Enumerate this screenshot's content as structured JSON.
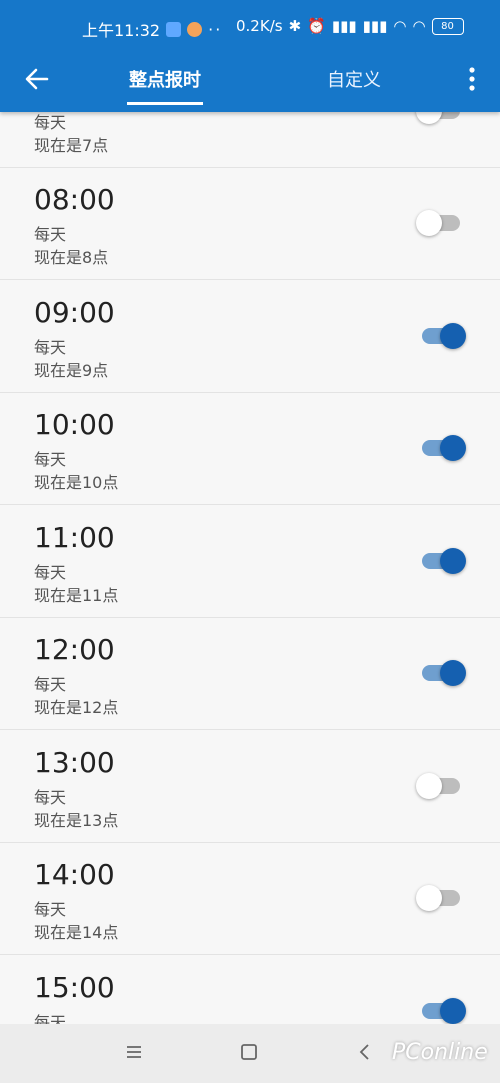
{
  "status_bar": {
    "time": "上午11:32",
    "speed": "0.2K/s",
    "battery": "80",
    "icons": [
      "app-icon",
      "face-icon",
      "bluetooth-icon",
      "alarm-icon",
      "hd-signal-icon",
      "hd-signal-icon",
      "wifi-icon",
      "wifi-icon",
      "battery-icon"
    ]
  },
  "header": {
    "back_icon": "arrow-left-icon",
    "tabs": [
      {
        "label": "整点报时",
        "active": true
      },
      {
        "label": "自定义",
        "active": false
      }
    ],
    "more_icon": "more-vertical-icon"
  },
  "alarms": [
    {
      "time": "",
      "repeat": "每天",
      "desc": "现在是7点",
      "enabled": false
    },
    {
      "time": "08:00",
      "repeat": "每天",
      "desc": "现在是8点",
      "enabled": false
    },
    {
      "time": "09:00",
      "repeat": "每天",
      "desc": "现在是9点",
      "enabled": true
    },
    {
      "time": "10:00",
      "repeat": "每天",
      "desc": "现在是10点",
      "enabled": true
    },
    {
      "time": "11:00",
      "repeat": "每天",
      "desc": "现在是11点",
      "enabled": true
    },
    {
      "time": "12:00",
      "repeat": "每天",
      "desc": "现在是12点",
      "enabled": true
    },
    {
      "time": "13:00",
      "repeat": "每天",
      "desc": "现在是13点",
      "enabled": false
    },
    {
      "time": "14:00",
      "repeat": "每天",
      "desc": "现在是14点",
      "enabled": false
    },
    {
      "time": "15:00",
      "repeat": "每天",
      "desc": "",
      "enabled": true
    }
  ],
  "nav_bar": {
    "icons": [
      "menu-icon",
      "home-square-icon",
      "back-chevron-icon"
    ],
    "watermark": "PConline"
  },
  "colors": {
    "accent": "#1677c9",
    "toggle_on": "#1560b0",
    "toggle_off": "#bdbdbd"
  }
}
